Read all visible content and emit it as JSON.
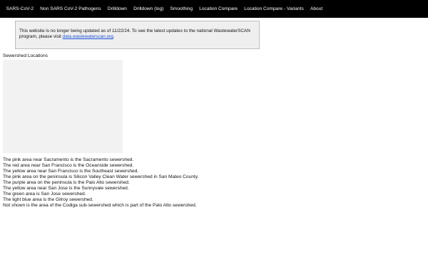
{
  "nav": {
    "items": [
      {
        "label": "SARS-CoV-2"
      },
      {
        "label": "Non SARS CoV-2 Pathogens"
      },
      {
        "label": "Drilldown"
      },
      {
        "label": "Drilldown (log)"
      },
      {
        "label": "Smoothing"
      },
      {
        "label": "Location Compare"
      },
      {
        "label": "Location Compare - Variants"
      },
      {
        "label": "About"
      }
    ]
  },
  "notice": {
    "text": "This website is no longer being updated as of 11/22/24. To see the latest updates to the national WastewaterSCAN program, please visit ",
    "link_text": "data.wastewaterscan.org",
    "suffix": "."
  },
  "sewershed": {
    "title": "Sewershed Locations",
    "descriptions": [
      "The pink area near Sacramento is the Sacramento sewershed.",
      "The red area near San Francisco is the Oceanside sewershed.",
      "The yellow area near San Francisco is the Southeast sewershed.",
      "The pink area on the peninsula is Silicon Valley Clean Water sewershed in San Mateo County.",
      "The purple area on the peninsula is the Palo Alto sewershed.",
      "The yellow area near San Jose is the Sunnyvale sewershed.",
      "The green area is San Jose sewershed.",
      "The light blue area is the Gilroy sewershed.",
      "Not shown is the area of the Codiga sub-sewershed which is part of the Palo Alto sewershed."
    ]
  },
  "colors": {
    "nav_background": "#000000",
    "nav_text": "#ffffff",
    "notice_background": "#efefef",
    "notice_border": "#bdbdbd",
    "link": "#1a4fd6",
    "map_placeholder": "#f2f2f2"
  }
}
